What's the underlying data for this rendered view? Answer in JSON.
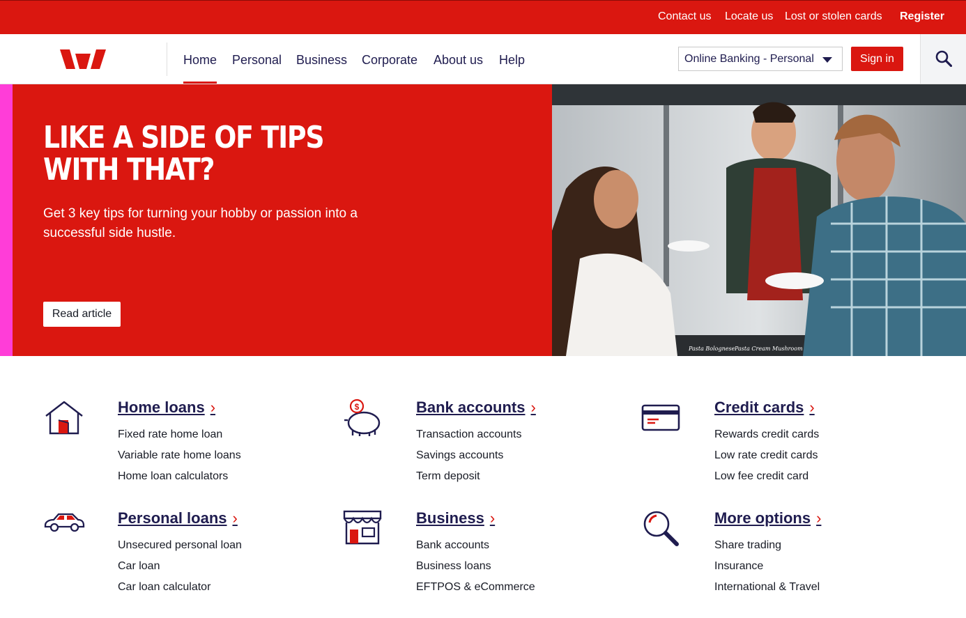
{
  "utility_nav": {
    "contact": "Contact us",
    "locate": "Locate us",
    "lost_cards": "Lost or stolen cards",
    "register": "Register"
  },
  "main_nav": {
    "items": [
      "Home",
      "Personal",
      "Business",
      "Corporate",
      "About us",
      "Help"
    ],
    "active": "Home"
  },
  "banking_select": {
    "value": "Online Banking - Personal"
  },
  "signin": {
    "label": "Sign in"
  },
  "hero": {
    "title": "LIKE A SIDE OF TIPS WITH THAT?",
    "subtitle": "Get 3 key tips for turning your hobby or passion into a successful side hustle.",
    "cta": "Read article",
    "photo_signs": [
      "Pasta Bolognese",
      "Pasta Cream Mushroom"
    ]
  },
  "products": [
    {
      "title": "Home loans",
      "icon": "house-icon",
      "links": [
        "Fixed rate home loan",
        "Variable rate home loans",
        "Home loan calculators"
      ]
    },
    {
      "title": "Bank accounts",
      "icon": "piggy-bank-icon",
      "links": [
        "Transaction accounts",
        "Savings accounts",
        "Term deposit"
      ]
    },
    {
      "title": "Credit cards",
      "icon": "credit-card-icon",
      "links": [
        "Rewards credit cards",
        "Low rate credit cards",
        "Low fee credit card"
      ]
    },
    {
      "title": "Personal loans",
      "icon": "car-icon",
      "links": [
        "Unsecured personal loan",
        "Car loan",
        "Car loan calculator"
      ]
    },
    {
      "title": "Business",
      "icon": "shopfront-icon",
      "links": [
        "Bank accounts",
        "Business loans",
        "EFTPOS & eCommerce"
      ]
    },
    {
      "title": "More options",
      "icon": "magnifier-icon",
      "links": [
        "Share trading",
        "Insurance",
        "International & Travel"
      ]
    }
  ],
  "colors": {
    "brand_red": "#da1710",
    "navy": "#1f1c4f",
    "accent_pink": "#ff3dd8"
  }
}
